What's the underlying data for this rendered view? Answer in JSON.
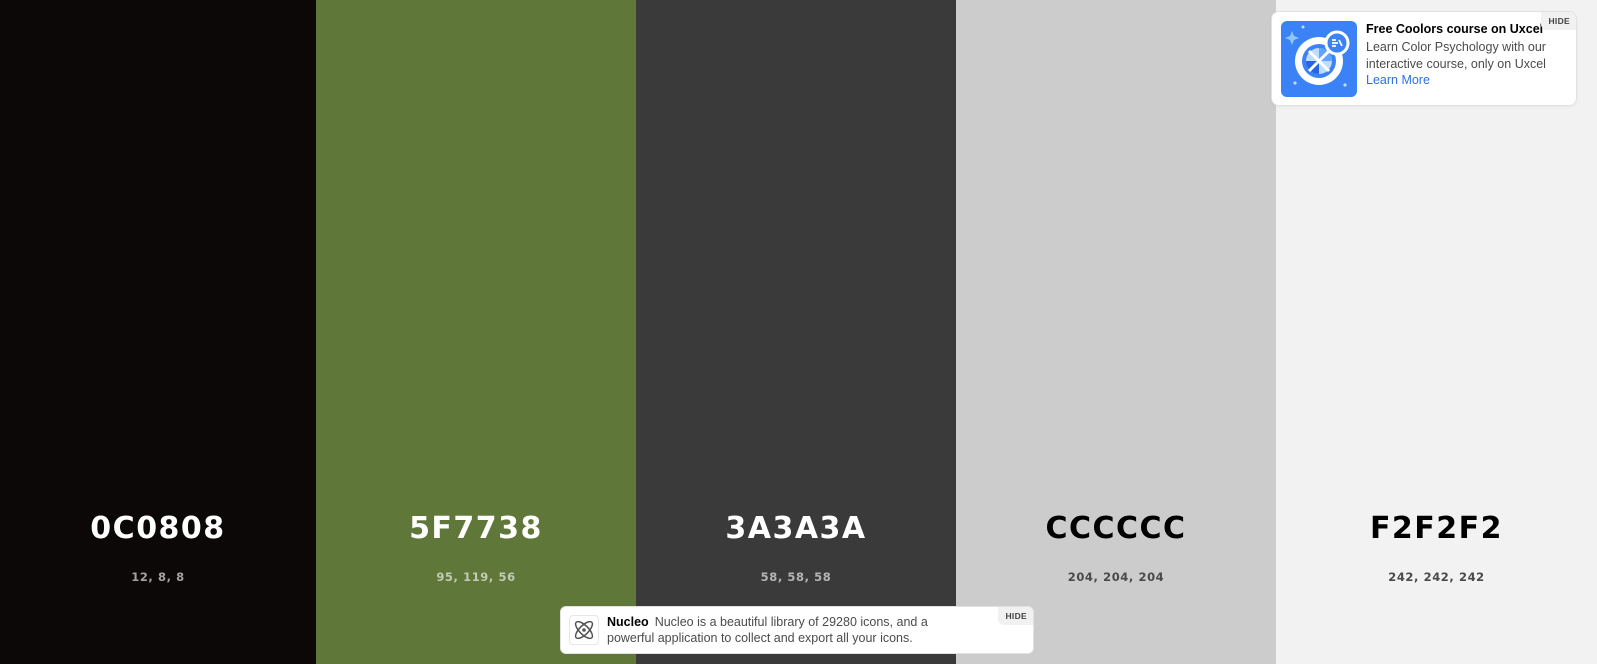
{
  "palette": {
    "colors": [
      {
        "hex": "0C0808",
        "rgb": "12, 8, 8",
        "color": "#0C0808",
        "tone": "dark"
      },
      {
        "hex": "5F7738",
        "rgb": "95, 119, 56",
        "color": "#5F7738",
        "tone": "dark"
      },
      {
        "hex": "3A3A3A",
        "rgb": "58, 58, 58",
        "color": "#3A3A3A",
        "tone": "dark"
      },
      {
        "hex": "CCCCCC",
        "rgb": "204, 204, 204",
        "color": "#CCCCCC",
        "tone": "light"
      },
      {
        "hex": "F2F2F2",
        "rgb": "242, 242, 242",
        "color": "#F2F2F2",
        "tone": "light"
      }
    ]
  },
  "promo": {
    "title": "Free Coolors course on Uxcel",
    "body": "Learn Color Psychology with our interactive course, only on Uxcel",
    "link": "Learn More",
    "hide": "HIDE",
    "icon": "uxcel-course-logo",
    "accent": "#3B82F6"
  },
  "nucleo": {
    "name": "Nucleo",
    "text": "Nucleo is a beautiful library of 29280 icons, and a powerful application to collect and export all your icons.",
    "hide": "HIDE",
    "icon": "atom-icon"
  }
}
